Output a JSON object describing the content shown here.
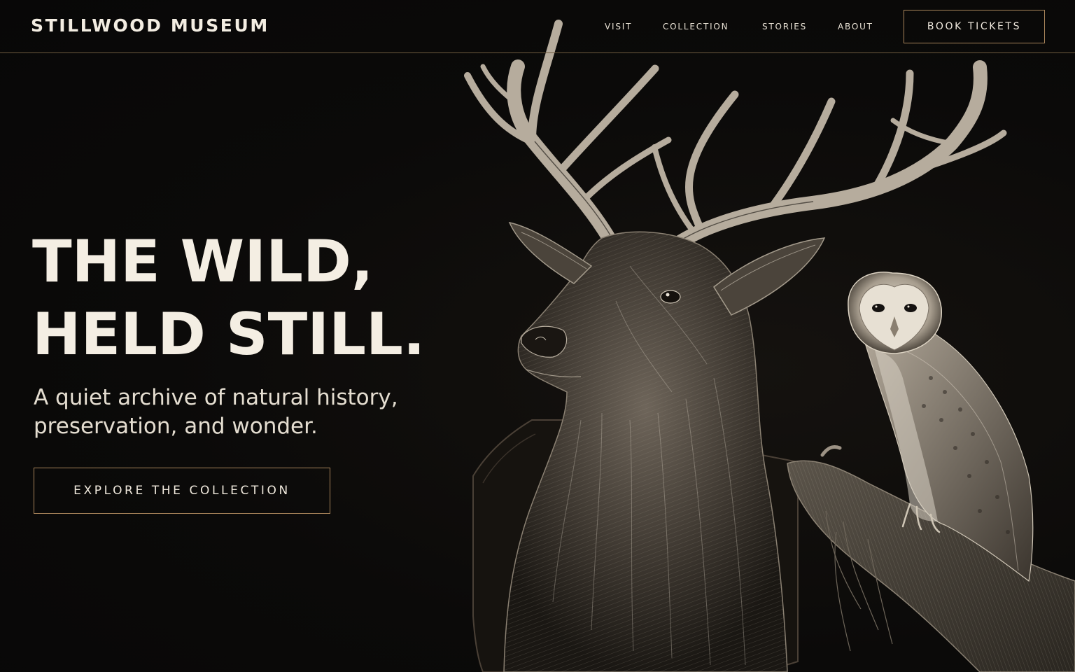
{
  "header": {
    "brand": "STILLWOOD MUSEUM",
    "nav": [
      {
        "label": "VISIT"
      },
      {
        "label": "COLLECTION"
      },
      {
        "label": "STORIES"
      },
      {
        "label": "ABOUT"
      }
    ],
    "cta_label": "BOOK TICKETS"
  },
  "hero": {
    "title_lines": [
      "THE WILD,",
      "HELD STILL."
    ],
    "subtitle_lines": [
      "A quiet archive of natural history,",
      "preservation, and wonder."
    ],
    "button_label": "EXPLORE THE COLLECTION"
  },
  "illustration": {
    "subjects": [
      "stag-head-mount",
      "barn-owl-on-branch"
    ]
  },
  "colors": {
    "background": "#0b0a09",
    "text": "#f4eee3",
    "accent_border": "#a8845a",
    "divider": "#6d5a3e"
  }
}
